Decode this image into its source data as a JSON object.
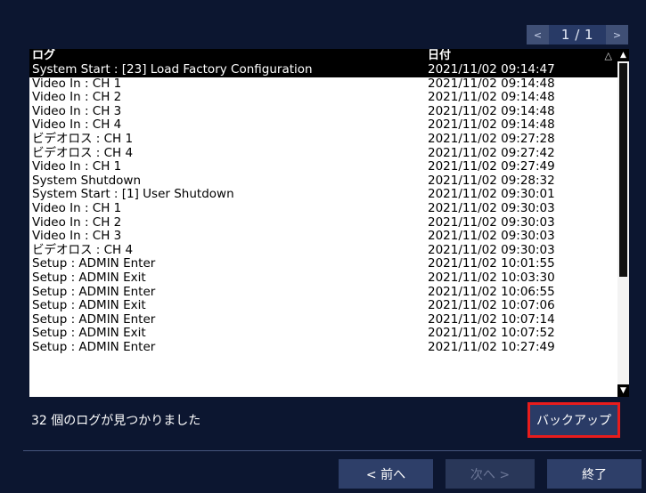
{
  "pager": {
    "prev": "<",
    "page": "1 / 1",
    "next": ">"
  },
  "log": {
    "headers": {
      "event": "ログ",
      "date": "日付",
      "sort_icon": "△"
    },
    "rows": [
      {
        "event": "System Start : [23] Load Factory Configuration",
        "date": "2021/11/02 09:14:47"
      },
      {
        "event": "Video In : CH 1",
        "date": "2021/11/02 09:14:48"
      },
      {
        "event": "Video In : CH 2",
        "date": "2021/11/02 09:14:48"
      },
      {
        "event": "Video In : CH 3",
        "date": "2021/11/02 09:14:48"
      },
      {
        "event": "Video In : CH 4",
        "date": "2021/11/02 09:14:48"
      },
      {
        "event": "ビデオロス : CH 1",
        "date": "2021/11/02 09:27:28"
      },
      {
        "event": "ビデオロス : CH 4",
        "date": "2021/11/02 09:27:42"
      },
      {
        "event": "Video In : CH 1",
        "date": "2021/11/02 09:27:49"
      },
      {
        "event": "System Shutdown",
        "date": "2021/11/02 09:28:32"
      },
      {
        "event": "System Start : [1] User Shutdown",
        "date": "2021/11/02 09:30:01"
      },
      {
        "event": "Video In : CH 1",
        "date": "2021/11/02 09:30:03"
      },
      {
        "event": "Video In : CH 2",
        "date": "2021/11/02 09:30:03"
      },
      {
        "event": "Video In : CH 3",
        "date": "2021/11/02 09:30:03"
      },
      {
        "event": "ビデオロス : CH 4",
        "date": "2021/11/02 09:30:03"
      },
      {
        "event": "Setup   : ADMIN Enter",
        "date": "2021/11/02 10:01:55"
      },
      {
        "event": "Setup   : ADMIN Exit",
        "date": "2021/11/02 10:03:30"
      },
      {
        "event": "Setup   : ADMIN Enter",
        "date": "2021/11/02 10:06:55"
      },
      {
        "event": "Setup   : ADMIN Exit",
        "date": "2021/11/02 10:07:06"
      },
      {
        "event": "Setup   : ADMIN Enter",
        "date": "2021/11/02 10:07:14"
      },
      {
        "event": "Setup   : ADMIN Exit",
        "date": "2021/11/02 10:07:52"
      },
      {
        "event": "Setup   : ADMIN Enter",
        "date": "2021/11/02 10:27:49"
      }
    ],
    "selected_index": 0
  },
  "footer": {
    "found_text": "32 個のログが見つかりました",
    "backup_label": "バックアップ",
    "prev_label": "< 前へ",
    "next_label": "次へ >",
    "exit_label": "終了"
  },
  "colors": {
    "background": "#0c1630",
    "button": "#2e3f69",
    "highlight": "#e81c1c"
  }
}
